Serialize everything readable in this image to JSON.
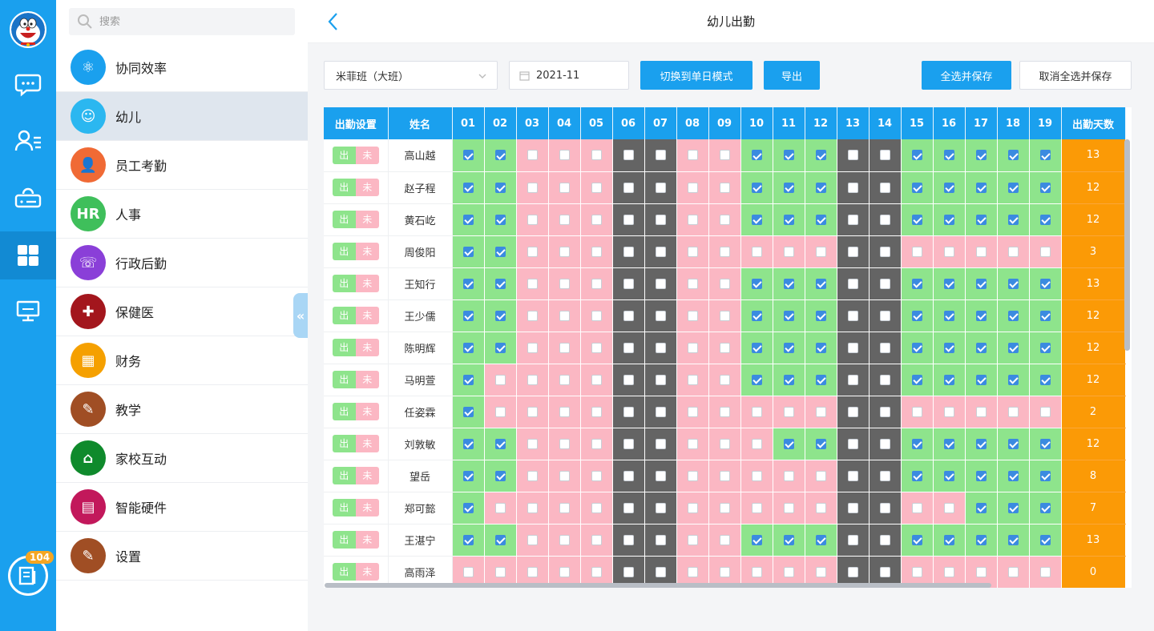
{
  "rail": {
    "items": [
      {
        "name": "chat-icon"
      },
      {
        "name": "contacts-icon"
      },
      {
        "name": "cloud-drive-icon"
      },
      {
        "name": "apps-grid-icon"
      },
      {
        "name": "monitor-icon"
      }
    ],
    "active_index": 3,
    "badge_count": "104"
  },
  "sidebar": {
    "search_placeholder": "搜索",
    "items": [
      {
        "label": "协同效率",
        "icon": "atom-icon",
        "color": "#1aa0ee",
        "glyph": "⚛"
      },
      {
        "label": "幼儿",
        "icon": "child-face-icon",
        "color": "#2bb7f0",
        "glyph": "☺"
      },
      {
        "label": "员工考勤",
        "icon": "staff-attendance-icon",
        "color": "#f06a35",
        "glyph": "👤"
      },
      {
        "label": "人事",
        "icon": "hr-icon",
        "color": "#3fbf5b",
        "glyph": "HR"
      },
      {
        "label": "行政后勤",
        "icon": "admin-logistics-icon",
        "color": "#8a3fd8",
        "glyph": "☏"
      },
      {
        "label": "保健医",
        "icon": "health-doctor-icon",
        "color": "#a3161d",
        "glyph": "✚"
      },
      {
        "label": "财务",
        "icon": "finance-icon",
        "color": "#f5a000",
        "glyph": "▦"
      },
      {
        "label": "教学",
        "icon": "teaching-icon",
        "color": "#a04e24",
        "glyph": "✎"
      },
      {
        "label": "家校互动",
        "icon": "home-school-icon",
        "color": "#0f8a2c",
        "glyph": "⌂"
      },
      {
        "label": "智能硬件",
        "icon": "smart-hardware-icon",
        "color": "#c2185b",
        "glyph": "▤"
      },
      {
        "label": "设置",
        "icon": "settings-icon",
        "color": "#a04e24",
        "glyph": "✎"
      }
    ],
    "active_index": 1
  },
  "header": {
    "title": "幼儿出勤"
  },
  "toolbar": {
    "class_select": "米菲班（大班）",
    "date": "2021-11",
    "switch_mode_label": "切换到单日模式",
    "export_label": "导出",
    "select_all_save_label": "全选并保存",
    "cancel_all_save_label": "取消全选并保存"
  },
  "table": {
    "col_setting": "出勤设置",
    "col_name": "姓名",
    "col_days": "出勤天数",
    "days": [
      "01",
      "02",
      "03",
      "04",
      "05",
      "06",
      "07",
      "08",
      "09",
      "10",
      "11",
      "12",
      "13",
      "14",
      "15",
      "16",
      "17",
      "18",
      "19"
    ],
    "weekend_days": [
      "06",
      "07",
      "13",
      "14"
    ],
    "toggle_in": "出",
    "toggle_out": "未",
    "rows": [
      {
        "name": "高山越",
        "checks": "1100000001110011111",
        "days": "13"
      },
      {
        "name": "赵子程",
        "checks": "1100000001110011111",
        "days": "12"
      },
      {
        "name": "黄石屹",
        "checks": "1100000001110011111",
        "days": "12"
      },
      {
        "name": "周俊阳",
        "checks": "1100000000000000000",
        "days": "3"
      },
      {
        "name": "王知行",
        "checks": "1100000001110011111",
        "days": "13"
      },
      {
        "name": "王少儒",
        "checks": "1100000001110011111",
        "days": "12"
      },
      {
        "name": "陈明辉",
        "checks": "1100000001110011111",
        "days": "12"
      },
      {
        "name": "马明萱",
        "checks": "1000000001110011111",
        "days": "12"
      },
      {
        "name": "任姿霖",
        "checks": "1000000000000000000",
        "days": "2"
      },
      {
        "name": "刘敦敏",
        "checks": "1100000000110011111",
        "days": "12"
      },
      {
        "name": "望岳",
        "checks": "1100000000000011111",
        "days": "8"
      },
      {
        "name": "郑可懿",
        "checks": "1000000000000000111",
        "days": "7"
      },
      {
        "name": "王湛宁",
        "checks": "1100000001110011111",
        "days": "13"
      },
      {
        "name": "高雨泽",
        "checks": "0000000000000000000",
        "days": "0"
      }
    ]
  },
  "colors": {
    "primary": "#1aa0ee",
    "present": "#8ee48c",
    "absent": "#fbb7c3",
    "weekend": "#646464",
    "days_total": "#fb9a06"
  }
}
